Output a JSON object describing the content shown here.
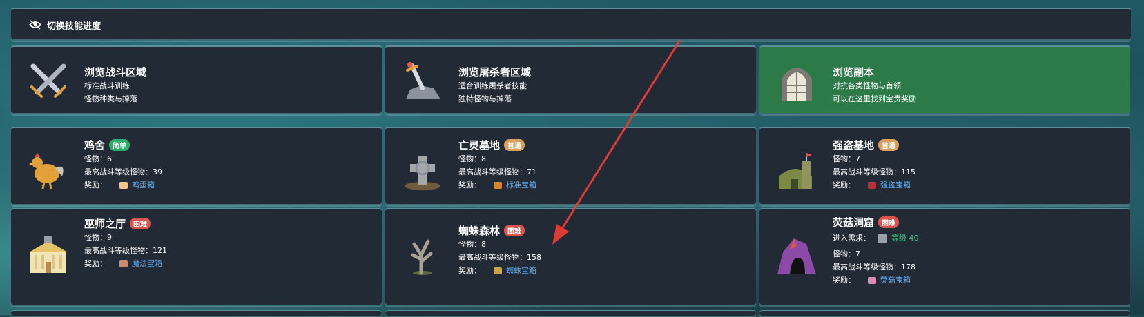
{
  "topbar": {
    "label": "切换技能进度",
    "icon": "eye-slash-icon"
  },
  "browse": [
    {
      "title": "浏览战斗区域",
      "line1": "标准战斗训练",
      "line2": "怪物种类与掉落",
      "icon": "crossed-swords-icon"
    },
    {
      "title": "浏览屠杀者区域",
      "line1": "适合训练屠杀者技能",
      "line2": "独特怪物与掉落",
      "icon": "sword-in-stone-icon"
    },
    {
      "title": "浏览副本",
      "line1": "对抗各类怪物与首领",
      "line2": "可以在这里找到宝贵奖励",
      "icon": "dungeon-door-icon",
      "accent": "#2b7a48"
    }
  ],
  "labels": {
    "monsters": "怪物：",
    "max_level": "最高战斗等级怪物：",
    "reward": "奖励：",
    "entry_req": "进入需求："
  },
  "areas": [
    {
      "name": "鸡舍",
      "difficulty": "简单",
      "monsters": "6",
      "max_level": "39",
      "reward": "鸡蛋箱",
      "icon": "rooster-icon"
    },
    {
      "name": "亡灵墓地",
      "difficulty": "普通",
      "monsters": "8",
      "max_level": "71",
      "reward": "标准宝箱",
      "icon": "tombstone-icon"
    },
    {
      "name": "强盗基地",
      "difficulty": "普通",
      "monsters": "7",
      "max_level": "115",
      "reward": "强盗宝箱",
      "icon": "bandit-base-icon"
    },
    {
      "name": "巫师之厅",
      "difficulty": "困难",
      "monsters": "9",
      "max_level": "121",
      "reward": "魔法宝箱",
      "icon": "wizard-hall-icon"
    },
    {
      "name": "蜘蛛森林",
      "difficulty": "困难",
      "monsters": "8",
      "max_level": "158",
      "reward": "蜘蛛宝箱",
      "icon": "dead-tree-icon"
    },
    {
      "name": "荧菇洞窟",
      "difficulty": "困难",
      "requirement": "等级 40",
      "monsters": "7",
      "max_level": "178",
      "reward": "荧菇宝箱",
      "icon": "cave-icon"
    }
  ],
  "colors": {
    "easy": "#2dab6b",
    "normal": "#d9a05b",
    "hard": "#d9534f",
    "panel": "#222a35",
    "reward_link": "#5fa8e8"
  }
}
